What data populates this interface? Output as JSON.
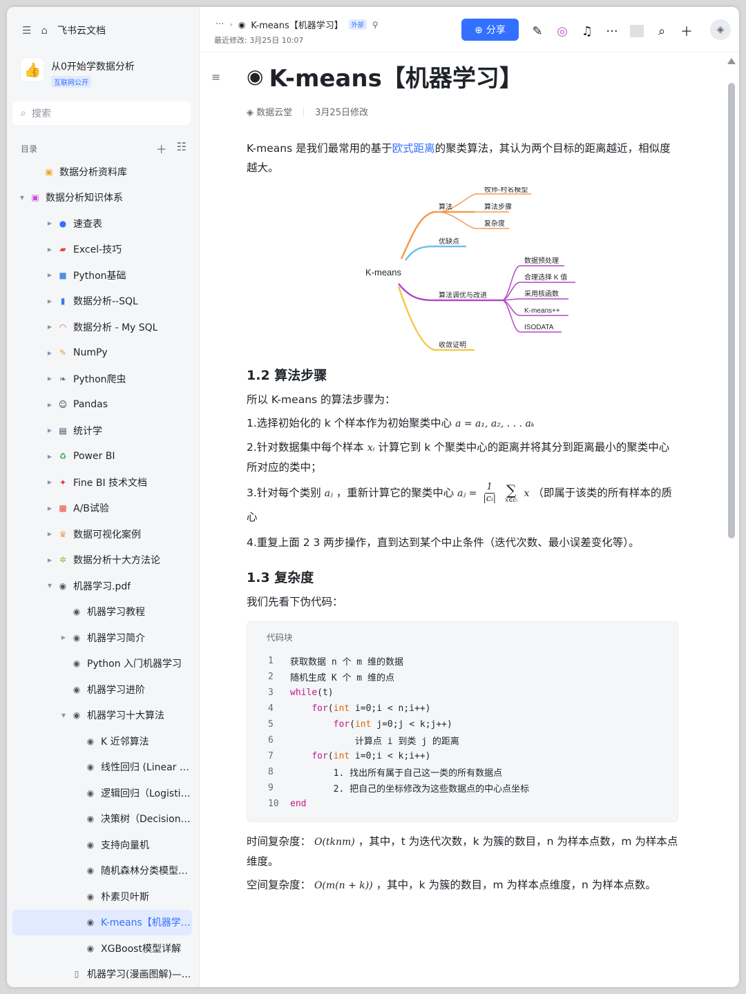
{
  "sidebar": {
    "home_label": "飞书云文档",
    "wiki": {
      "title": "从0开始学数据分析",
      "badge": "互联网公开",
      "logo_icon": "thumbs-up-icon"
    },
    "search_placeholder": "搜索",
    "toc_label": "目录",
    "tree": [
      {
        "label": "数据分析资料库",
        "icon": "▣",
        "arrow": "",
        "indent": 1,
        "color": "#f5a623"
      },
      {
        "label": "数据分析知识体系",
        "icon": "▣",
        "arrow": "▼",
        "indent": 0,
        "color": "#c94fd4"
      },
      {
        "label": "速查表",
        "icon": "●",
        "arrow": "▶",
        "indent": 2,
        "color": "#3370ff"
      },
      {
        "label": "Excel-技巧",
        "icon": "▰",
        "arrow": "▶",
        "indent": 2,
        "color": "#e8473c"
      },
      {
        "label": "Python基础",
        "icon": "■",
        "arrow": "▶",
        "indent": 2,
        "color": "#4a90e2"
      },
      {
        "label": "数据分析--SQL",
        "icon": "▮",
        "arrow": "▶",
        "indent": 2,
        "color": "#3a78e8"
      },
      {
        "label": "数据分析 - My SQL",
        "icon": "◠",
        "arrow": "▶",
        "indent": 2,
        "color": "#f25c54"
      },
      {
        "label": "NumPy",
        "icon": "✎",
        "arrow": "▶",
        "indent": 2,
        "color": "#e89b3c"
      },
      {
        "label": "Python爬虫",
        "icon": "❧",
        "arrow": "▶",
        "indent": 2,
        "color": "#5b6b8c"
      },
      {
        "label": "Pandas",
        "icon": "☺",
        "arrow": "▶",
        "indent": 2,
        "color": "#333333"
      },
      {
        "label": "统计学",
        "icon": "▤",
        "arrow": "▶",
        "indent": 2,
        "color": "#2d3a5c"
      },
      {
        "label": "Power BI",
        "icon": "♻",
        "arrow": "▶",
        "indent": 2,
        "color": "#3aa757"
      },
      {
        "label": "Fine BI 技术文档",
        "icon": "✦",
        "arrow": "▶",
        "indent": 2,
        "color": "#e8313c"
      },
      {
        "label": "A/B试验",
        "icon": "▩",
        "arrow": "▶",
        "indent": 2,
        "color": "#e8473c"
      },
      {
        "label": "数据可视化案例",
        "icon": "♛",
        "arrow": "▶",
        "indent": 2,
        "color": "#e8a33c"
      },
      {
        "label": "数据分析十大方法论",
        "icon": "✲",
        "arrow": "▶",
        "indent": 2,
        "color": "#7cc43c"
      },
      {
        "label": "机器学习.pdf",
        "icon": "◉",
        "arrow": "▼",
        "indent": 2,
        "color": "#555555"
      },
      {
        "label": "机器学习教程",
        "icon": "◉",
        "arrow": "",
        "indent": 3,
        "color": "#555555"
      },
      {
        "label": "机器学习简介",
        "icon": "◉",
        "arrow": "▶",
        "indent": 3,
        "color": "#555555"
      },
      {
        "label": "Python 入门机器学习",
        "icon": "◉",
        "arrow": "",
        "indent": 3,
        "color": "#555555"
      },
      {
        "label": "机器学习进阶",
        "icon": "◉",
        "arrow": "",
        "indent": 3,
        "color": "#555555"
      },
      {
        "label": "机器学习十大算法",
        "icon": "◉",
        "arrow": "▼",
        "indent": 3,
        "color": "#555555"
      },
      {
        "label": "K 近邻算法",
        "icon": "◉",
        "arrow": "",
        "indent": 4,
        "color": "#555555"
      },
      {
        "label": "线性回归 (Linear Re...",
        "icon": "◉",
        "arrow": "",
        "indent": 4,
        "color": "#555555"
      },
      {
        "label": "逻辑回归（Logistic ...",
        "icon": "◉",
        "arrow": "",
        "indent": 4,
        "color": "#555555"
      },
      {
        "label": "决策树（Decision Tr...",
        "icon": "◉",
        "arrow": "",
        "indent": 4,
        "color": "#555555"
      },
      {
        "label": "支持向量机",
        "icon": "◉",
        "arrow": "",
        "indent": 4,
        "color": "#555555"
      },
      {
        "label": "随机森林分类模型详...",
        "icon": "◉",
        "arrow": "",
        "indent": 4,
        "color": "#555555"
      },
      {
        "label": "朴素贝叶斯",
        "icon": "◉",
        "arrow": "",
        "indent": 4,
        "color": "#555555"
      },
      {
        "label": "K-means【机器学习】",
        "icon": "◉",
        "arrow": "",
        "indent": 4,
        "color": "#555555",
        "active": true
      },
      {
        "label": "XGBoost模型详解",
        "icon": "◉",
        "arrow": "",
        "indent": 4,
        "color": "#555555"
      },
      {
        "label": "机器学习(漫画图解)—...",
        "icon": "▯",
        "arrow": "",
        "indent": 3,
        "color": "#646a73"
      }
    ]
  },
  "header": {
    "breadcrumb_more": "···",
    "breadcrumb_title": "K-means【机器学习】",
    "external_badge": "外部",
    "last_modified": "最近修改: 3月25日 10:07",
    "share_label": "分享"
  },
  "doc": {
    "title": "K-means【机器学习】",
    "author": "数据云堂",
    "modified": "3月25日修改",
    "intro_before": "K-means 是我们最常用的基于",
    "intro_link": "欧式距离",
    "intro_after": "的聚类算法，其认为两个目标的距离越近，相似度越大。",
    "mindmap": {
      "root": "K-means",
      "nodes": {
        "algo": "算法",
        "model": "牧师-村名模型",
        "steps": "算法步骤",
        "complexity": "复杂度",
        "pros": "优缺点",
        "tuning": "算法调优与改进",
        "pre": "数据预处理",
        "choosek": "合理选择 K 值",
        "kernel": "采用核函数",
        "kpp": "K-means++",
        "isodata": "ISODATA",
        "proof": "收敛证明"
      }
    },
    "sec12_title": "1.2 算法步骤",
    "sec12_lead": "所以 K-means 的算法步骤为：",
    "step1_text": "1.选择初始化的 k 个样本作为初始聚类中心",
    "step1_math": "a = a₁, a₂, . . . aₖ",
    "step2_a": "2.针对数据集中每个样本",
    "step2_math": "xᵢ",
    "step2_b": "计算它到 k 个聚类中心的距离并将其分到距离最小的聚类中心所对应的类中；",
    "step3_a": "3.针对每个类别",
    "step3_math": "aⱼ",
    "step3_b": "，重新计算它的聚类中心",
    "step3_lhs": "aⱼ =",
    "step3_num": "1",
    "step3_den": "|cᵢ|",
    "step3_sum": "∑",
    "step3_sub": "x∈cᵢ",
    "step3_x": "x",
    "step3_c": "（即属于该类的所有样本的质心",
    "step4": "4.重复上面 2 3 两步操作，直到达到某个中止条件（迭代次数、最小误差变化等）。",
    "sec13_title": "1.3 复杂度",
    "sec13_lead": "我们先看下伪代码：",
    "code_label": "代码块",
    "code": [
      {
        "n": "1",
        "t": "获取数据 n 个 m 维的数据"
      },
      {
        "n": "2",
        "t": "随机生成 K 个 m 维的点"
      },
      {
        "n": "3",
        "t": "while(t)"
      },
      {
        "n": "4",
        "t": "    for(int i=0;i < n;i++)"
      },
      {
        "n": "5",
        "t": "        for(int j=0;j < k;j++)"
      },
      {
        "n": "6",
        "t": "            计算点 i 到类 j 的距离"
      },
      {
        "n": "7",
        "t": "    for(int i=0;i < k;i++)"
      },
      {
        "n": "8",
        "t": "        1. 找出所有属于自己这一类的所有数据点"
      },
      {
        "n": "9",
        "t": "        2. 把自己的坐标修改为这些数据点的中心点坐标"
      },
      {
        "n": "10",
        "t": "end"
      }
    ],
    "time_a": "时间复杂度：",
    "time_math": "O(tknm)",
    "time_b": "，其中，t 为迭代次数，k 为簇的数目，n 为样本点数，m 为样本点维度。",
    "space_a": "空间复杂度：",
    "space_math": "O(m(n + k))",
    "space_b": "，其中，k 为簇的数目，m 为样本点维度，n 为样本点数。"
  }
}
